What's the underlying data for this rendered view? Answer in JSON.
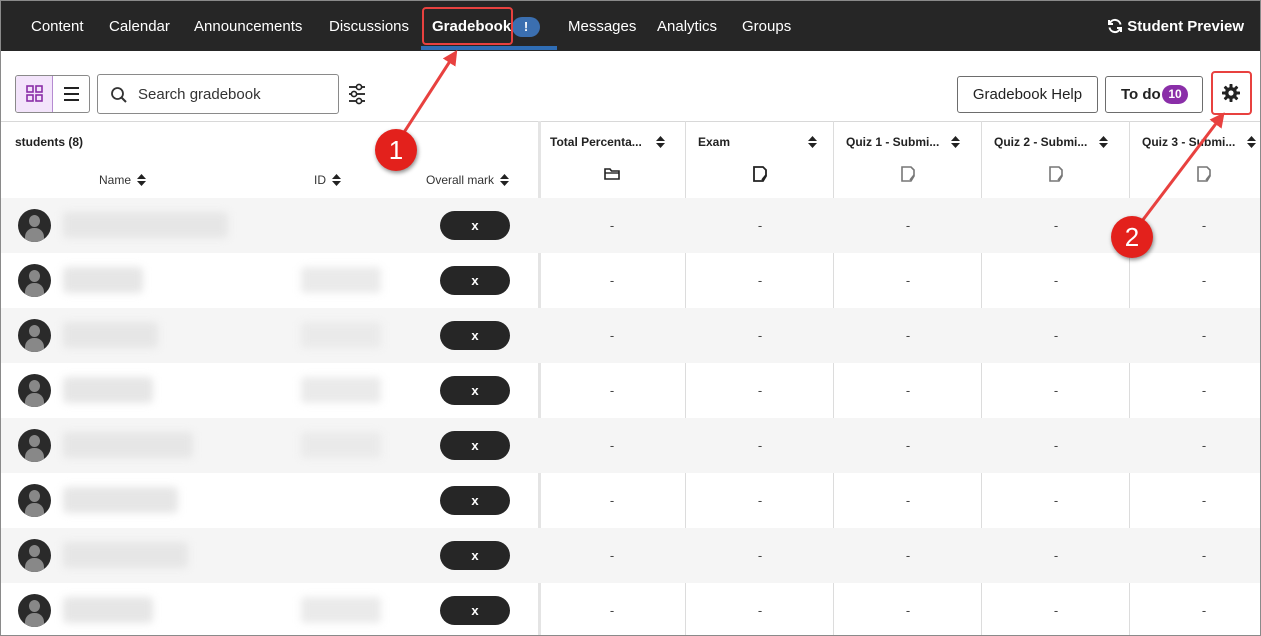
{
  "nav": {
    "items": [
      "Content",
      "Calendar",
      "Announcements",
      "Discussions",
      "Gradebook",
      "Messages",
      "Analytics",
      "Groups"
    ],
    "active": "Gradebook",
    "alert_badge": "!",
    "student_preview": "Student Preview"
  },
  "toolbar": {
    "search_placeholder": "Search gradebook",
    "help_label": "Gradebook Help",
    "todo_label": "To do",
    "todo_count": "10"
  },
  "grid": {
    "students_label": "students (8)",
    "columns": {
      "name": "Name",
      "id": "ID",
      "overall": "Overall mark"
    },
    "items": [
      {
        "title": "Total Percenta...",
        "icon": "folder-icon"
      },
      {
        "title": "Exam",
        "icon": "document-icon"
      },
      {
        "title": "Quiz 1 - Submi...",
        "icon": "document-icon"
      },
      {
        "title": "Quiz 2 - Submi...",
        "icon": "document-icon"
      },
      {
        "title": "Quiz 3 - Submi...",
        "icon": "document-icon"
      }
    ],
    "rows": [
      {
        "overall": "x",
        "cells": [
          "-",
          "-",
          "-",
          "-",
          "-"
        ]
      },
      {
        "overall": "x",
        "cells": [
          "-",
          "-",
          "-",
          "-",
          "-"
        ]
      },
      {
        "overall": "x",
        "cells": [
          "-",
          "-",
          "-",
          "-",
          "-"
        ]
      },
      {
        "overall": "x",
        "cells": [
          "-",
          "-",
          "-",
          "-",
          "-"
        ]
      },
      {
        "overall": "x",
        "cells": [
          "-",
          "-",
          "-",
          "-",
          "-"
        ]
      },
      {
        "overall": "x",
        "cells": [
          "-",
          "-",
          "-",
          "-",
          "-"
        ]
      },
      {
        "overall": "x",
        "cells": [
          "-",
          "-",
          "-",
          "-",
          "-"
        ]
      },
      {
        "overall": "x",
        "cells": [
          "-",
          "-",
          "-",
          "-",
          "-"
        ]
      }
    ]
  },
  "annotations": {
    "callout_1": "1",
    "callout_2": "2",
    "color": "#e3211c"
  },
  "colors": {
    "nav_bg": "#262626",
    "accent_purple": "#8a2ea8",
    "nav_underline": "#2f6db5"
  }
}
